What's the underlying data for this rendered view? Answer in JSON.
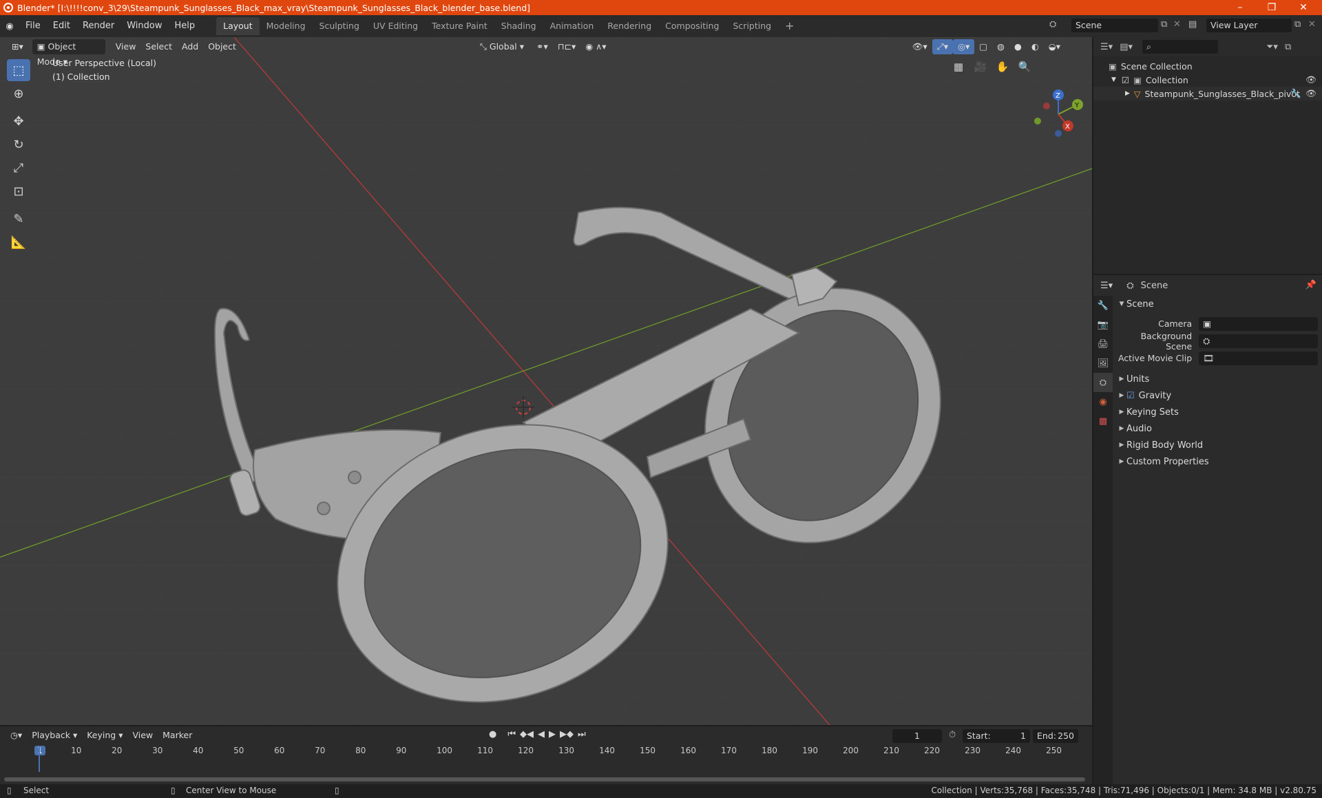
{
  "title": "Blender* [I:\\!!!!conv_3\\29\\Steampunk_Sunglasses_Black_max_vray\\Steampunk_Sunglasses_Black_blender_base.blend]",
  "menu": [
    "File",
    "Edit",
    "Render",
    "Window",
    "Help"
  ],
  "workspaces": [
    "Layout",
    "Modeling",
    "Sculpting",
    "UV Editing",
    "Texture Paint",
    "Shading",
    "Animation",
    "Rendering",
    "Compositing",
    "Scripting"
  ],
  "scene_field": "Scene",
  "view_layer_field": "View Layer",
  "viewport": {
    "mode": "Object Mode",
    "menus": [
      "View",
      "Select",
      "Add",
      "Object"
    ],
    "orientation": "Global",
    "perspective_label": "User Perspective (Local)",
    "collection_label": "(1) Collection",
    "gizmo": {
      "x": "X",
      "y": "Y",
      "z": "Z"
    }
  },
  "outliner": {
    "root": "Scene Collection",
    "collection": "Collection",
    "object": "Steampunk_Sunglasses_Black_pivot"
  },
  "properties": {
    "header": "Scene",
    "section": "Scene",
    "camera_label": "Camera",
    "background_label": "Background Scene",
    "movieclip_label": "Active Movie Clip",
    "subsections": [
      "Units",
      "Gravity",
      "Keying Sets",
      "Audio",
      "Rigid Body World",
      "Custom Properties"
    ]
  },
  "timeline": {
    "menus": [
      "Playback",
      "Keying",
      "View",
      "Marker"
    ],
    "current_frame": "1",
    "start_label": "Start:",
    "start": "1",
    "end_label": "End:",
    "end": "250",
    "ticks": [
      "1",
      "10",
      "20",
      "30",
      "40",
      "50",
      "60",
      "70",
      "80",
      "90",
      "100",
      "110",
      "120",
      "130",
      "140",
      "150",
      "160",
      "170",
      "180",
      "190",
      "200",
      "210",
      "220",
      "230",
      "240",
      "250"
    ]
  },
  "status": {
    "left": "Select",
    "middle": "Center View to Mouse",
    "right": "Collection | Verts:35,768 | Faces:35,748 | Tris:71,496 | Objects:0/1 | Mem: 34.8 MB | v2.80.75"
  },
  "colors": {
    "accent": "#4a72b0",
    "titlebar": "#e0470f",
    "x_axis": "#c0392b",
    "y_axis": "#7ea32b"
  }
}
